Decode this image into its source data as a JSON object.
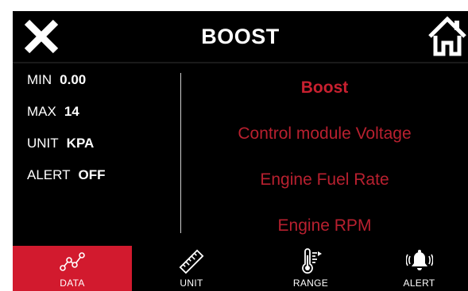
{
  "header": {
    "title": "BOOST",
    "close_icon": "close-icon",
    "home_icon": "home-icon"
  },
  "info": {
    "min_label": "MIN",
    "min_value": "0.00",
    "max_label": "MAX",
    "max_value": "14",
    "unit_label": "UNIT",
    "unit_value": "KPA",
    "alert_label": "ALERT",
    "alert_value": "OFF"
  },
  "options": [
    {
      "label": "Boost",
      "active": true
    },
    {
      "label": "Control module Voltage",
      "active": false
    },
    {
      "label": "Engine Fuel Rate",
      "active": false
    },
    {
      "label": "Engine RPM",
      "active": false
    }
  ],
  "tabs": [
    {
      "label": "DATA",
      "icon": "data-graph-icon",
      "active": true
    },
    {
      "label": "UNIT",
      "icon": "ruler-icon",
      "active": false
    },
    {
      "label": "RANGE",
      "icon": "thermometer-icon",
      "active": false
    },
    {
      "label": "ALERT",
      "icon": "bell-icon",
      "active": false
    }
  ],
  "colors": {
    "accent": "#d21a2e",
    "option_text": "#b8202f",
    "background": "#000000",
    "text": "#ffffff"
  }
}
